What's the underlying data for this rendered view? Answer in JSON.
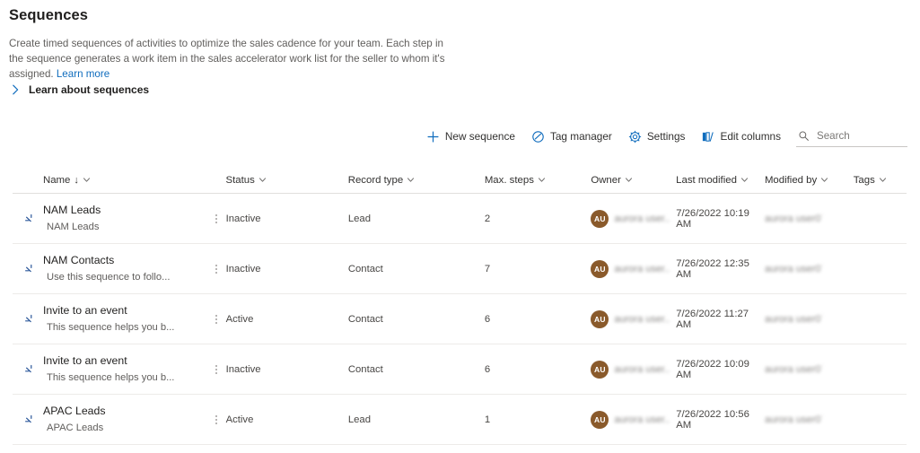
{
  "header": {
    "title": "Sequences",
    "description_part1": "Create timed sequences of activities to optimize the sales cadence for your team. Each step in the sequence generates a work item in the sales accelerator work list for the seller to whom it's assigned. ",
    "learn_more_label": "Learn more"
  },
  "learn_section": {
    "label": "Learn about sequences",
    "chevron_icon": "chevron-right-icon"
  },
  "commandbar": {
    "new_sequence": {
      "label": "New sequence",
      "icon": "plus-icon"
    },
    "tag_manager": {
      "label": "Tag manager",
      "icon": "tag-icon"
    },
    "settings": {
      "label": "Settings",
      "icon": "gear-icon"
    },
    "edit_columns": {
      "label": "Edit columns",
      "icon": "columns-icon"
    },
    "search": {
      "placeholder": "Search",
      "value": "",
      "icon": "search-icon"
    }
  },
  "grid": {
    "columns": [
      {
        "key": "name",
        "label": "Name",
        "sorted": "ascending",
        "sort_glyph": "↓"
      },
      {
        "key": "status",
        "label": "Status"
      },
      {
        "key": "record_type",
        "label": "Record type"
      },
      {
        "key": "max_steps",
        "label": "Max. steps"
      },
      {
        "key": "owner",
        "label": "Owner"
      },
      {
        "key": "last_modified",
        "label": "Last modified"
      },
      {
        "key": "modified_by",
        "label": "Modified by"
      },
      {
        "key": "tags",
        "label": "Tags"
      }
    ],
    "rows": [
      {
        "name": "NAM Leads",
        "subtitle": "NAM Leads",
        "status": "Inactive",
        "record_type": "Lead",
        "max_steps": "2",
        "owner_initials": "AU",
        "owner_name": "aurora user...",
        "last_modified": "7/26/2022 10:19 AM",
        "modified_by": "aurora user07",
        "tags": ""
      },
      {
        "name": "NAM Contacts",
        "subtitle": "Use this sequence to follo...",
        "status": "Inactive",
        "record_type": "Contact",
        "max_steps": "7",
        "owner_initials": "AU",
        "owner_name": "aurora user...",
        "last_modified": "7/26/2022 12:35 AM",
        "modified_by": "aurora user07",
        "tags": ""
      },
      {
        "name": "Invite to an event",
        "subtitle": "This sequence helps you b...",
        "status": "Active",
        "record_type": "Contact",
        "max_steps": "6",
        "owner_initials": "AU",
        "owner_name": "aurora user...",
        "last_modified": "7/26/2022 11:27 AM",
        "modified_by": "aurora user07",
        "tags": ""
      },
      {
        "name": "Invite to an event",
        "subtitle": "This sequence helps you b...",
        "status": "Inactive",
        "record_type": "Contact",
        "max_steps": "6",
        "owner_initials": "AU",
        "owner_name": "aurora user...",
        "last_modified": "7/26/2022 10:09 AM",
        "modified_by": "aurora user07",
        "tags": ""
      },
      {
        "name": "APAC Leads",
        "subtitle": "APAC Leads",
        "status": "Active",
        "record_type": "Lead",
        "max_steps": "1",
        "owner_initials": "AU",
        "owner_name": "aurora user...",
        "last_modified": "7/26/2022 10:56 AM",
        "modified_by": "aurora user07",
        "tags": ""
      }
    ],
    "row_icon": "sequence-icon",
    "row_menu_icon": "more-options-icon"
  },
  "colors": {
    "accent": "#0f6cbd",
    "link": "#0f6cbd",
    "avatar_bg": "#8a5a2b",
    "text": "#323130",
    "muted": "#605e5c",
    "divider": "#edebe9"
  }
}
